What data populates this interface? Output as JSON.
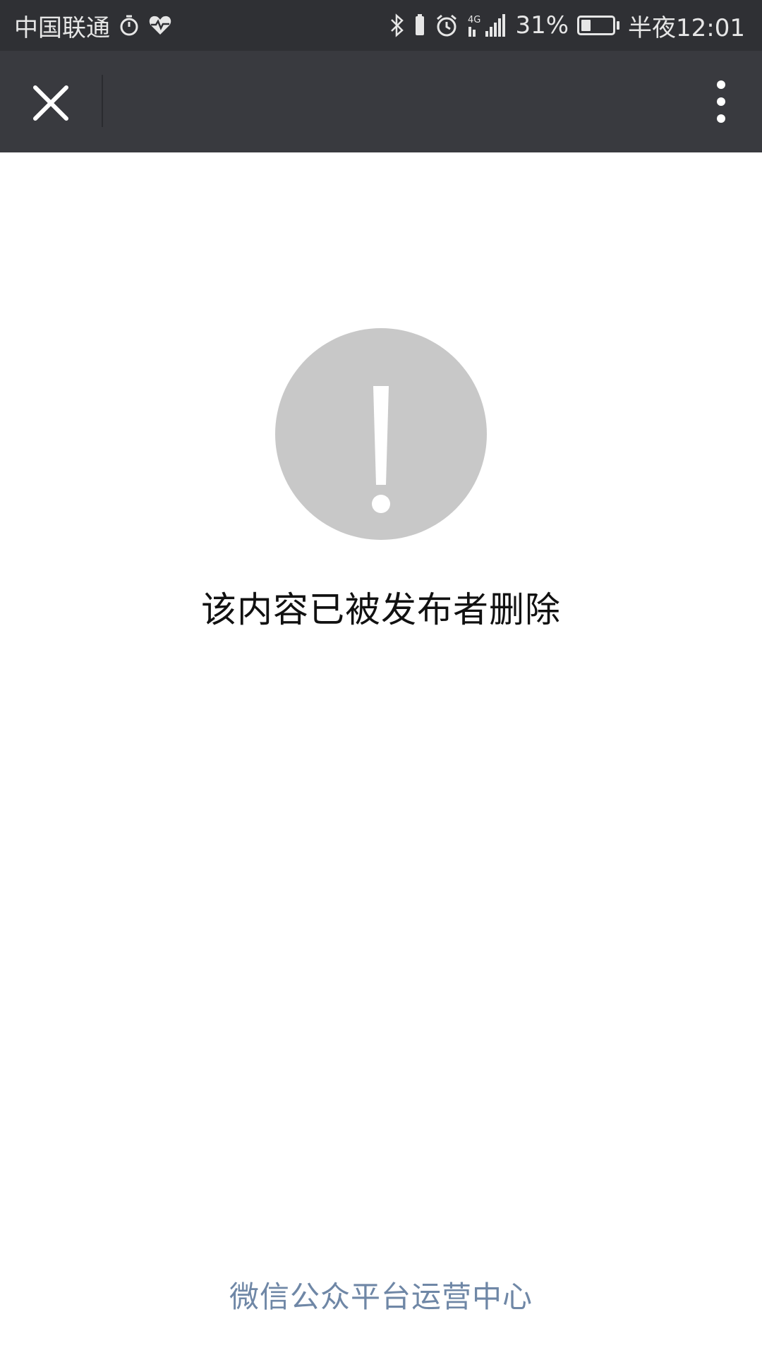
{
  "status_bar": {
    "carrier": "中国联通",
    "network": "4G",
    "battery_percent": "31%",
    "battery_level": 0.31,
    "time": "半夜12:01",
    "icons": [
      "stopwatch-icon",
      "heart-rate-icon",
      "bluetooth-icon",
      "alarm-icon",
      "signal-icon",
      "battery-icon"
    ]
  },
  "title_bar": {
    "close_icon": "close-icon",
    "menu_icon": "more-vertical-icon"
  },
  "content": {
    "warning_icon": "exclamation-icon",
    "message": "该内容已被发布者删除"
  },
  "footer": {
    "link": "微信公众平台运营中心"
  },
  "colors": {
    "status_bar_bg": "#2f3034",
    "title_bar_bg": "#393a3f",
    "warning_circle": "#c8c8c8",
    "footer_link": "#6f87a6"
  }
}
